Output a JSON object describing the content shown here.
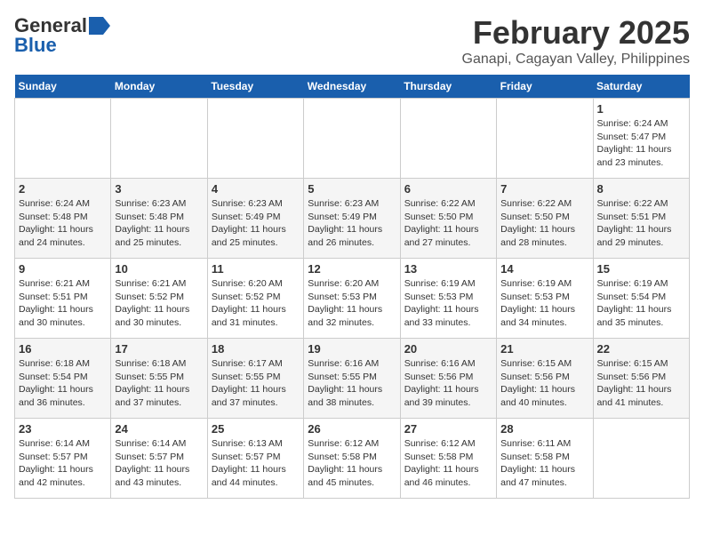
{
  "header": {
    "logo_general": "General",
    "logo_blue": "Blue",
    "month_title": "February 2025",
    "location": "Ganapi, Cagayan Valley, Philippines"
  },
  "weekdays": [
    "Sunday",
    "Monday",
    "Tuesday",
    "Wednesday",
    "Thursday",
    "Friday",
    "Saturday"
  ],
  "weeks": [
    [
      {
        "day": "",
        "sunrise": "",
        "sunset": "",
        "daylight": ""
      },
      {
        "day": "",
        "sunrise": "",
        "sunset": "",
        "daylight": ""
      },
      {
        "day": "",
        "sunrise": "",
        "sunset": "",
        "daylight": ""
      },
      {
        "day": "",
        "sunrise": "",
        "sunset": "",
        "daylight": ""
      },
      {
        "day": "",
        "sunrise": "",
        "sunset": "",
        "daylight": ""
      },
      {
        "day": "",
        "sunrise": "",
        "sunset": "",
        "daylight": ""
      },
      {
        "day": "1",
        "sunrise": "Sunrise: 6:24 AM",
        "sunset": "Sunset: 5:47 PM",
        "daylight": "Daylight: 11 hours and 23 minutes."
      }
    ],
    [
      {
        "day": "2",
        "sunrise": "Sunrise: 6:24 AM",
        "sunset": "Sunset: 5:48 PM",
        "daylight": "Daylight: 11 hours and 24 minutes."
      },
      {
        "day": "3",
        "sunrise": "Sunrise: 6:23 AM",
        "sunset": "Sunset: 5:48 PM",
        "daylight": "Daylight: 11 hours and 25 minutes."
      },
      {
        "day": "4",
        "sunrise": "Sunrise: 6:23 AM",
        "sunset": "Sunset: 5:49 PM",
        "daylight": "Daylight: 11 hours and 25 minutes."
      },
      {
        "day": "5",
        "sunrise": "Sunrise: 6:23 AM",
        "sunset": "Sunset: 5:49 PM",
        "daylight": "Daylight: 11 hours and 26 minutes."
      },
      {
        "day": "6",
        "sunrise": "Sunrise: 6:22 AM",
        "sunset": "Sunset: 5:50 PM",
        "daylight": "Daylight: 11 hours and 27 minutes."
      },
      {
        "day": "7",
        "sunrise": "Sunrise: 6:22 AM",
        "sunset": "Sunset: 5:50 PM",
        "daylight": "Daylight: 11 hours and 28 minutes."
      },
      {
        "day": "8",
        "sunrise": "Sunrise: 6:22 AM",
        "sunset": "Sunset: 5:51 PM",
        "daylight": "Daylight: 11 hours and 29 minutes."
      }
    ],
    [
      {
        "day": "9",
        "sunrise": "Sunrise: 6:21 AM",
        "sunset": "Sunset: 5:51 PM",
        "daylight": "Daylight: 11 hours and 30 minutes."
      },
      {
        "day": "10",
        "sunrise": "Sunrise: 6:21 AM",
        "sunset": "Sunset: 5:52 PM",
        "daylight": "Daylight: 11 hours and 30 minutes."
      },
      {
        "day": "11",
        "sunrise": "Sunrise: 6:20 AM",
        "sunset": "Sunset: 5:52 PM",
        "daylight": "Daylight: 11 hours and 31 minutes."
      },
      {
        "day": "12",
        "sunrise": "Sunrise: 6:20 AM",
        "sunset": "Sunset: 5:53 PM",
        "daylight": "Daylight: 11 hours and 32 minutes."
      },
      {
        "day": "13",
        "sunrise": "Sunrise: 6:19 AM",
        "sunset": "Sunset: 5:53 PM",
        "daylight": "Daylight: 11 hours and 33 minutes."
      },
      {
        "day": "14",
        "sunrise": "Sunrise: 6:19 AM",
        "sunset": "Sunset: 5:53 PM",
        "daylight": "Daylight: 11 hours and 34 minutes."
      },
      {
        "day": "15",
        "sunrise": "Sunrise: 6:19 AM",
        "sunset": "Sunset: 5:54 PM",
        "daylight": "Daylight: 11 hours and 35 minutes."
      }
    ],
    [
      {
        "day": "16",
        "sunrise": "Sunrise: 6:18 AM",
        "sunset": "Sunset: 5:54 PM",
        "daylight": "Daylight: 11 hours and 36 minutes."
      },
      {
        "day": "17",
        "sunrise": "Sunrise: 6:18 AM",
        "sunset": "Sunset: 5:55 PM",
        "daylight": "Daylight: 11 hours and 37 minutes."
      },
      {
        "day": "18",
        "sunrise": "Sunrise: 6:17 AM",
        "sunset": "Sunset: 5:55 PM",
        "daylight": "Daylight: 11 hours and 37 minutes."
      },
      {
        "day": "19",
        "sunrise": "Sunrise: 6:16 AM",
        "sunset": "Sunset: 5:55 PM",
        "daylight": "Daylight: 11 hours and 38 minutes."
      },
      {
        "day": "20",
        "sunrise": "Sunrise: 6:16 AM",
        "sunset": "Sunset: 5:56 PM",
        "daylight": "Daylight: 11 hours and 39 minutes."
      },
      {
        "day": "21",
        "sunrise": "Sunrise: 6:15 AM",
        "sunset": "Sunset: 5:56 PM",
        "daylight": "Daylight: 11 hours and 40 minutes."
      },
      {
        "day": "22",
        "sunrise": "Sunrise: 6:15 AM",
        "sunset": "Sunset: 5:56 PM",
        "daylight": "Daylight: 11 hours and 41 minutes."
      }
    ],
    [
      {
        "day": "23",
        "sunrise": "Sunrise: 6:14 AM",
        "sunset": "Sunset: 5:57 PM",
        "daylight": "Daylight: 11 hours and 42 minutes."
      },
      {
        "day": "24",
        "sunrise": "Sunrise: 6:14 AM",
        "sunset": "Sunset: 5:57 PM",
        "daylight": "Daylight: 11 hours and 43 minutes."
      },
      {
        "day": "25",
        "sunrise": "Sunrise: 6:13 AM",
        "sunset": "Sunset: 5:57 PM",
        "daylight": "Daylight: 11 hours and 44 minutes."
      },
      {
        "day": "26",
        "sunrise": "Sunrise: 6:12 AM",
        "sunset": "Sunset: 5:58 PM",
        "daylight": "Daylight: 11 hours and 45 minutes."
      },
      {
        "day": "27",
        "sunrise": "Sunrise: 6:12 AM",
        "sunset": "Sunset: 5:58 PM",
        "daylight": "Daylight: 11 hours and 46 minutes."
      },
      {
        "day": "28",
        "sunrise": "Sunrise: 6:11 AM",
        "sunset": "Sunset: 5:58 PM",
        "daylight": "Daylight: 11 hours and 47 minutes."
      },
      {
        "day": "",
        "sunrise": "",
        "sunset": "",
        "daylight": ""
      }
    ]
  ]
}
